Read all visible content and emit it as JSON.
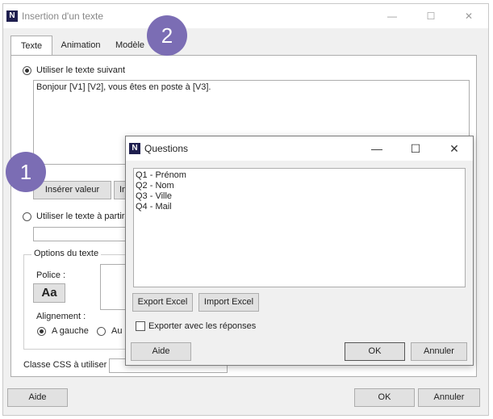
{
  "main_window": {
    "title": "Insertion d'un texte",
    "app_icon": "N",
    "controls": {
      "minimize": "—",
      "maximize": "☐",
      "close": "✕"
    },
    "tabs": [
      {
        "label": "Texte",
        "active": true
      },
      {
        "label": "Animation",
        "active": false
      },
      {
        "label": "Modèle",
        "active": false
      }
    ],
    "option_use_text": "Utiliser le texte suivant",
    "text_content": "Bonjour [V1] [V2], vous êtes en poste à [V3].",
    "insert_value_button": "Insérer valeur",
    "second_button_partial": "In",
    "option_use_text_from": "Utiliser le texte à partir",
    "text_options_group": "Options du texte",
    "font_label": "Police :",
    "font_button": "Aa",
    "alignment_label": "Alignement :",
    "align_left": "A gauche",
    "align_other_partial": "Au",
    "css_class_label": "Classe CSS à utiliser",
    "help_button": "Aide",
    "ok_button": "OK",
    "cancel_button": "Annuler"
  },
  "questions_dialog": {
    "title": "Questions",
    "app_icon": "N",
    "controls": {
      "minimize": "—",
      "maximize": "☐",
      "close": "✕"
    },
    "items": [
      "Q1 - Prénom",
      "Q2 - Nom",
      "Q3 - Ville",
      "Q4 - Mail"
    ],
    "export_excel": "Export Excel",
    "import_excel": "Import Excel",
    "export_with_answers": "Exporter avec les réponses",
    "help_button": "Aide",
    "ok_button": "OK",
    "cancel_button": "Annuler"
  },
  "badges": [
    "1",
    "2"
  ],
  "colors": {
    "badge": "#7b6db4",
    "app_icon_bg": "#1f1f4f"
  }
}
